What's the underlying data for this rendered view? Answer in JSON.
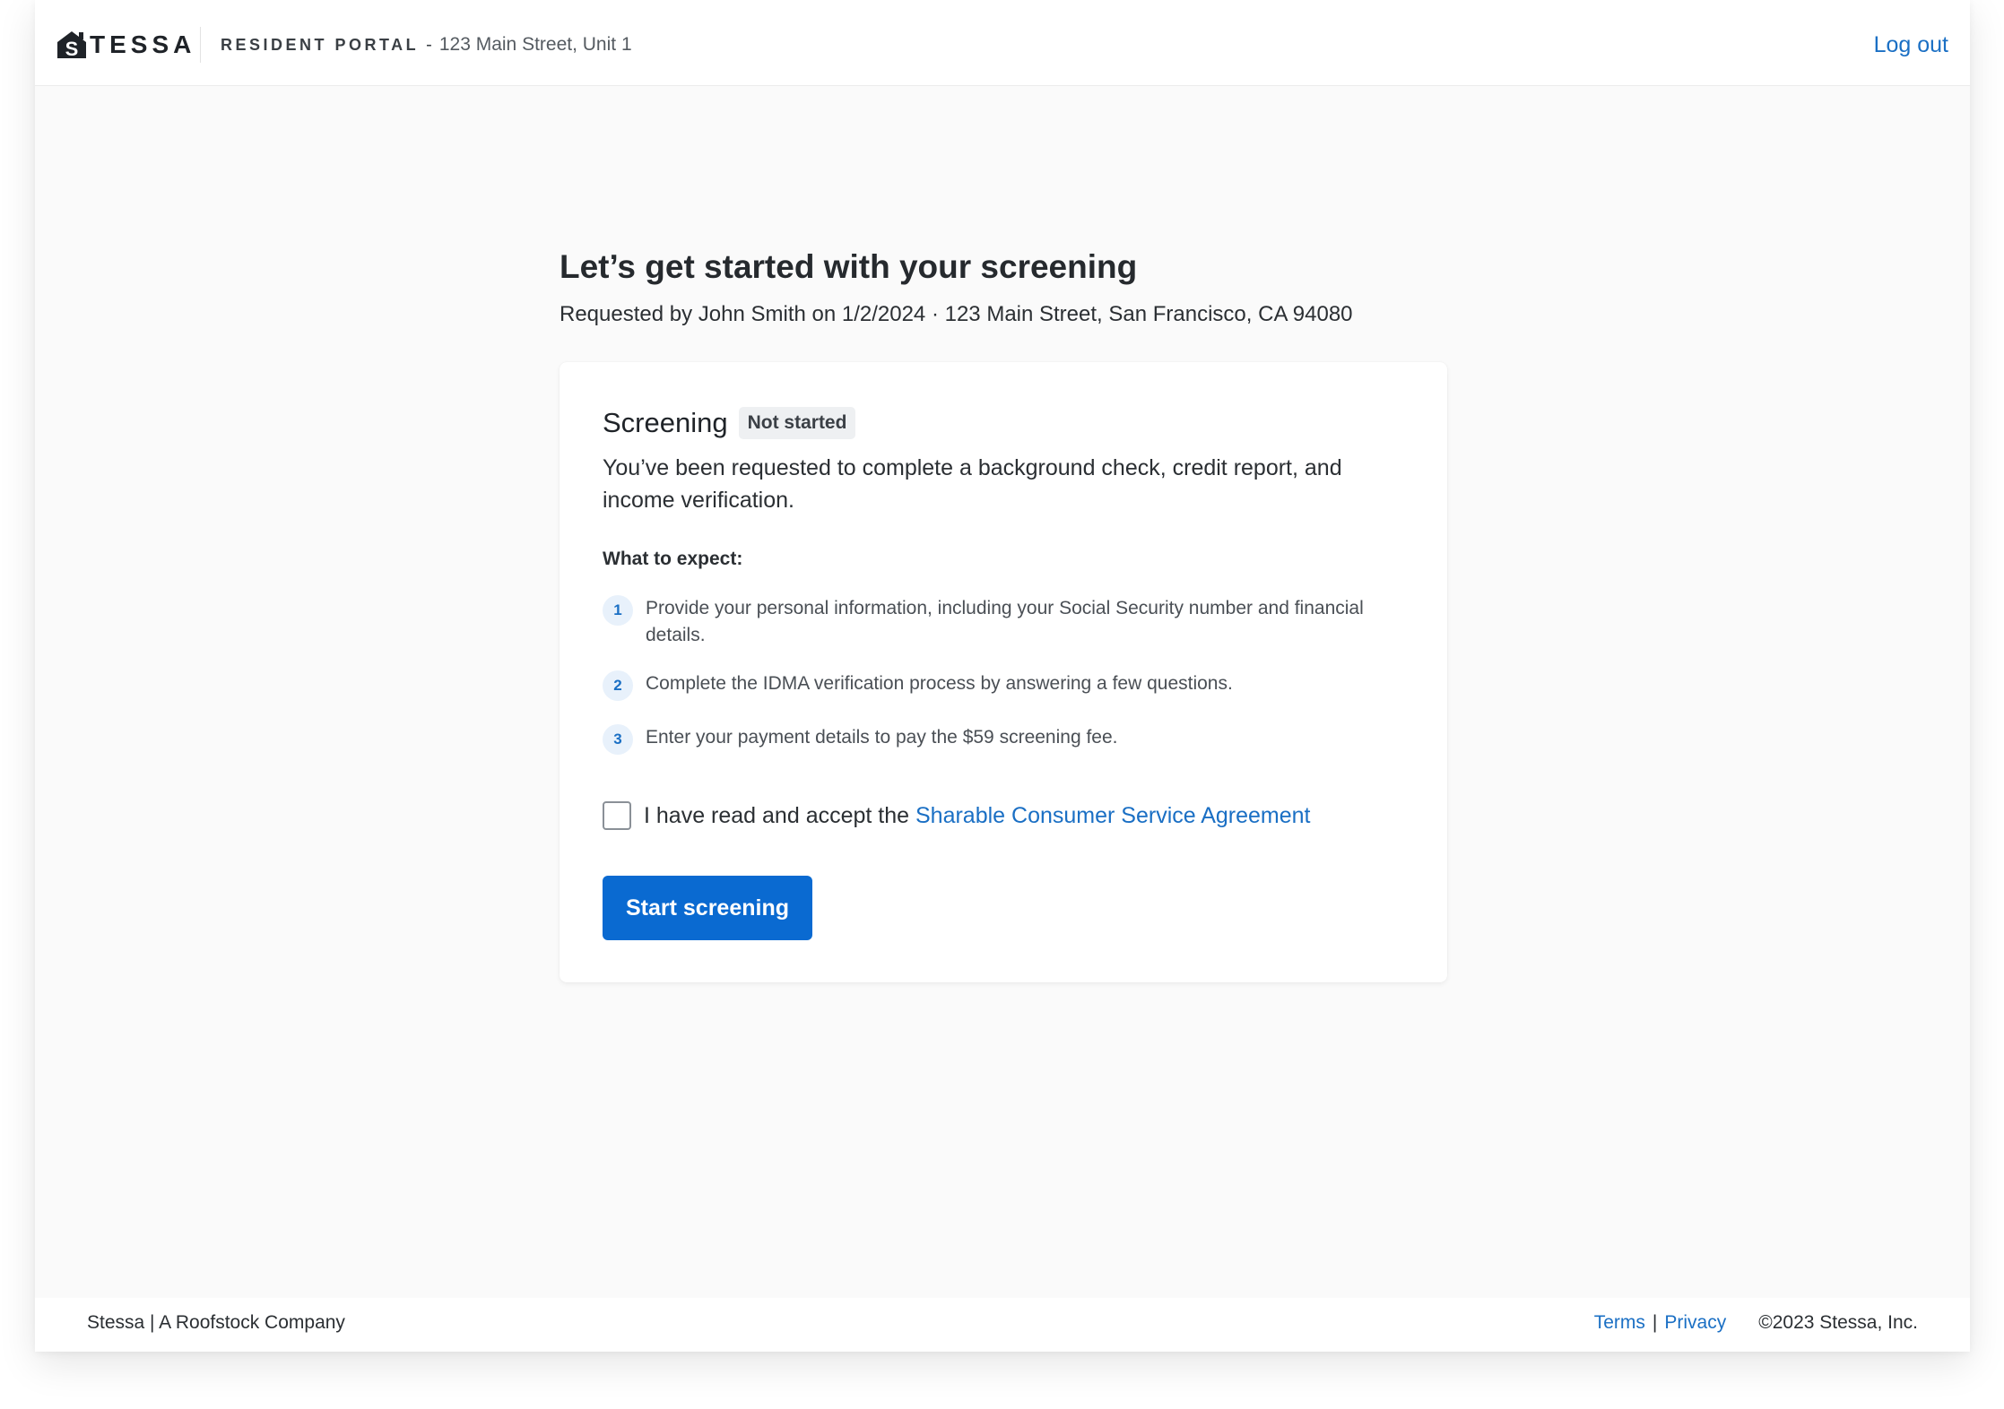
{
  "header": {
    "logo_text": "TESSA",
    "logo_letter": "S",
    "portal_label": "RESIDENT PORTAL",
    "portal_separator": "-",
    "portal_address": "123 Main Street, Unit 1",
    "logout_label": "Log out"
  },
  "main": {
    "title": "Let’s get started with your screening",
    "subtitle": "Requested by John Smith on 1/2/2024  · 123 Main Street, San Francisco, CA 94080"
  },
  "card": {
    "title": "Screening",
    "status_badge": "Not started",
    "description": "You’ve been requested to complete a background check, credit report, and income verification.",
    "expect_label": "What to expect:",
    "steps": [
      {
        "number": "1",
        "text": "Provide your personal information, including your Social Security number and financial details."
      },
      {
        "number": "2",
        "text": "Complete the IDMA verification process by answering a few questions."
      },
      {
        "number": "3",
        "text": "Enter your payment details to pay the $59 screening fee."
      }
    ],
    "consent_prefix": "I have read and accept the ",
    "consent_link": "Sharable Consumer Service Agreement",
    "start_button": "Start screening"
  },
  "footer": {
    "company": "Stessa | A Roofstock Company",
    "terms": "Terms",
    "pipe": "|",
    "privacy": "Privacy",
    "copyright": "©2023 Stessa, Inc."
  },
  "colors": {
    "accent": "#0a6ad1",
    "link": "#1a6fc4",
    "background": "#fafafa"
  }
}
